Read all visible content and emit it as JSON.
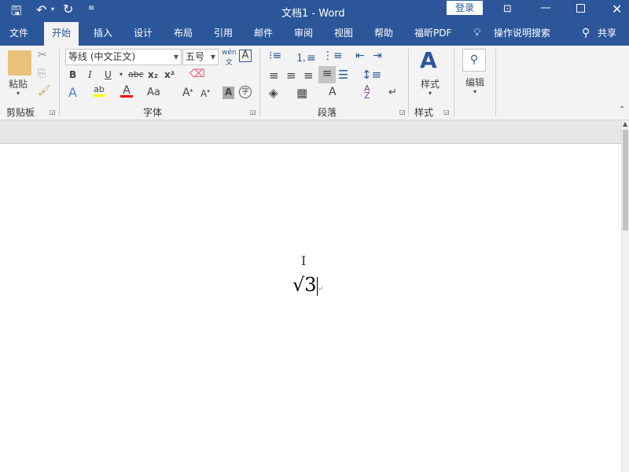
{
  "title_bar": {
    "title": "文档1  -  Word",
    "login": "登录"
  },
  "tabs": [
    "文件",
    "开始",
    "插入",
    "设计",
    "布局",
    "引用",
    "邮件",
    "审阅",
    "视图",
    "帮助",
    "福昕PDF"
  ],
  "tell_me": "操作说明搜索",
  "share": "共享",
  "clipboard": {
    "paste": "粘贴",
    "label": "剪贴板"
  },
  "font": {
    "name": "等线 (中文正文)",
    "size": "五号",
    "label": "字体",
    "bold": "B",
    "italic": "I",
    "underline": "U",
    "strike": "abc",
    "sub": "x₂",
    "sup": "x²",
    "case": "Aa"
  },
  "paragraph": {
    "label": "段落"
  },
  "styles": {
    "button": "样式",
    "label": "样式"
  },
  "editing": {
    "button": "编辑"
  },
  "document": {
    "content": "√3"
  },
  "colors": {
    "accent": "#2b579a",
    "highlight": "#ffff00",
    "font_color": "#ff0000"
  }
}
